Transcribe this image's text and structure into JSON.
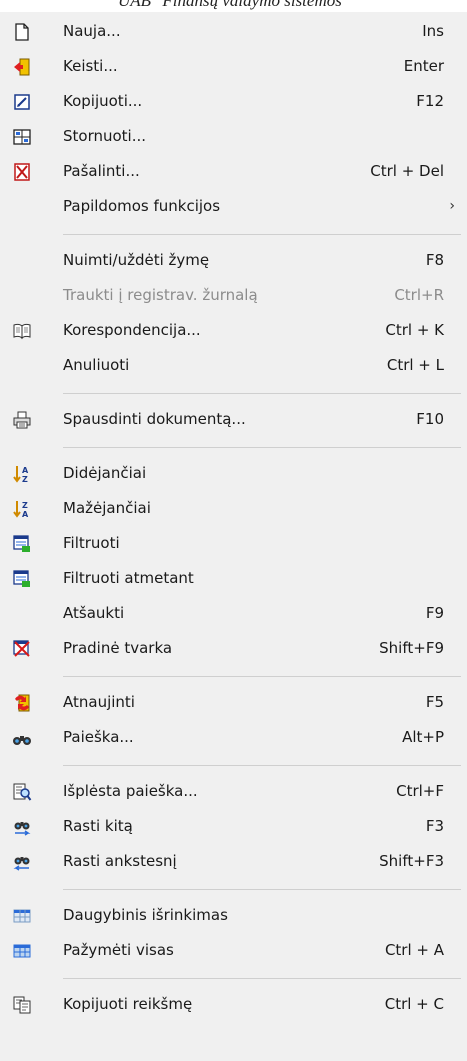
{
  "window": {
    "title": "UAB \"Finansų valdymo sistemos\""
  },
  "menu": {
    "items": [
      {
        "label": "Nauja...",
        "shortcut": "Ins"
      },
      {
        "label": "Keisti...",
        "shortcut": "Enter"
      },
      {
        "label": "Kopijuoti...",
        "shortcut": "F12"
      },
      {
        "label": "Stornuoti...",
        "shortcut": ""
      },
      {
        "label": "Pašalinti...",
        "shortcut": "Ctrl + Del"
      },
      {
        "label": "Papildomos funkcijos",
        "submenu_arrow": "›"
      },
      {
        "label": "Nuimti/uždėti žymę",
        "shortcut": "F8"
      },
      {
        "label": "Traukti į registrav. žurnalą",
        "shortcut": "Ctrl+R",
        "disabled": true
      },
      {
        "label": "Korespondencija...",
        "shortcut": "Ctrl + K"
      },
      {
        "label": "Anuliuoti",
        "shortcut": "Ctrl + L"
      },
      {
        "label": "Spausdinti dokumentą...",
        "shortcut": "F10"
      },
      {
        "label": "Didėjančiai",
        "shortcut": ""
      },
      {
        "label": "Mažėjančiai",
        "shortcut": ""
      },
      {
        "label": "Filtruoti",
        "shortcut": ""
      },
      {
        "label": "Filtruoti atmetant",
        "shortcut": ""
      },
      {
        "label": "Atšaukti",
        "shortcut": "F9"
      },
      {
        "label": "Pradinė tvarka",
        "shortcut": "Shift+F9"
      },
      {
        "label": "Atnaujinti",
        "shortcut": "F5"
      },
      {
        "label": "Paieška...",
        "shortcut": "Alt+P"
      },
      {
        "label": "Išplėsta paieška...",
        "shortcut": "Ctrl+F"
      },
      {
        "label": "Rasti kitą",
        "shortcut": "F3"
      },
      {
        "label": "Rasti ankstesnį",
        "shortcut": "Shift+F3"
      },
      {
        "label": "Daugybinis išrinkimas",
        "shortcut": ""
      },
      {
        "label": "Pažymėti visas",
        "shortcut": "Ctrl + A"
      },
      {
        "label": "Kopijuoti reikšmę",
        "shortcut": "Ctrl + C"
      }
    ]
  }
}
